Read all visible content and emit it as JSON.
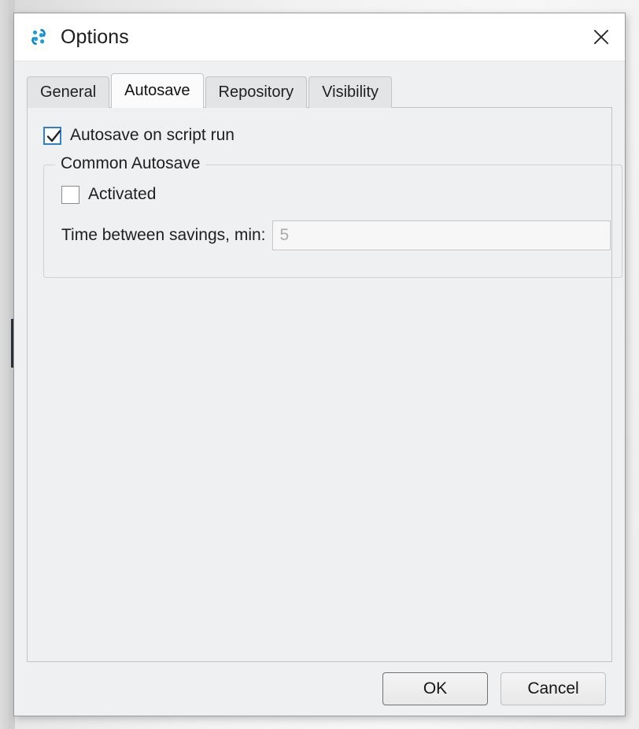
{
  "window": {
    "title": "Options",
    "icon": "sync-dots-icon",
    "close_label": "✕",
    "accent_color": "#2f7fd1"
  },
  "tabs": [
    {
      "label": "General",
      "active": false
    },
    {
      "label": "Autosave",
      "active": true
    },
    {
      "label": "Repository",
      "active": false
    },
    {
      "label": "Visibility",
      "active": false
    }
  ],
  "content": {
    "autosave_on_script_run": {
      "label": "Autosave on script run",
      "checked": true
    },
    "group": {
      "title": "Common Autosave",
      "activated": {
        "label": "Activated",
        "checked": false
      },
      "time_between_savings": {
        "label": "Time between savings, min:",
        "value": "5",
        "placeholder": "5",
        "enabled": false
      }
    }
  },
  "buttons": {
    "ok": "OK",
    "cancel": "Cancel"
  }
}
